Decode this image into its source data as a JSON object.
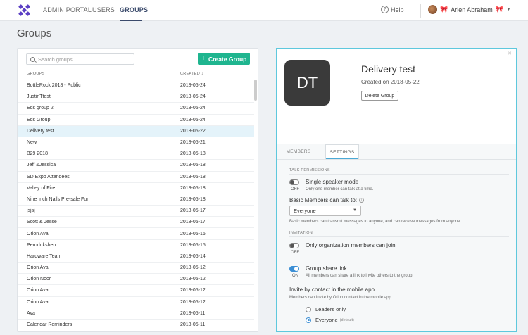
{
  "topnav": {
    "items": [
      {
        "label": "ADMIN PORTAL",
        "active": false
      },
      {
        "label": "USERS",
        "active": false
      },
      {
        "label": "GROUPS",
        "active": true
      }
    ],
    "help_label": "Help",
    "user_name": "Arlen Abraham"
  },
  "page": {
    "title": "Groups"
  },
  "groups_list": {
    "search_placeholder": "Search groups",
    "create_button_label": "Create Group",
    "columns": {
      "name": "GROUPS",
      "created": "CREATED"
    },
    "rows": [
      {
        "name": "BottleRock 2018 - Public",
        "created": "2018-05-24"
      },
      {
        "name": "JustinTtest",
        "created": "2018-05-24"
      },
      {
        "name": "Eds group 2",
        "created": "2018-05-24"
      },
      {
        "name": "Eds Group",
        "created": "2018-05-24"
      },
      {
        "name": "Delivery test",
        "created": "2018-05-22",
        "selected": true
      },
      {
        "name": "New",
        "created": "2018-05-21"
      },
      {
        "name": "B29 2018",
        "created": "2018-05-18"
      },
      {
        "name": "Jeff &Jessica",
        "created": "2018-05-18"
      },
      {
        "name": "SD Expo Attendees",
        "created": "2018-05-18"
      },
      {
        "name": "Valley of Fire",
        "created": "2018-05-18"
      },
      {
        "name": "Nine Inch Nails Pre-sale Fun",
        "created": "2018-05-18"
      },
      {
        "name": "jsjsj",
        "created": "2018-05-17"
      },
      {
        "name": "Scott & Jesse",
        "created": "2018-05-17"
      },
      {
        "name": "Orion Ava",
        "created": "2018-05-16"
      },
      {
        "name": "Perodukshen",
        "created": "2018-05-15"
      },
      {
        "name": "Hardware Team",
        "created": "2018-05-14"
      },
      {
        "name": "Orion Ava",
        "created": "2018-05-12"
      },
      {
        "name": "Orion Noor",
        "created": "2018-05-12"
      },
      {
        "name": "Orion Ava",
        "created": "2018-05-12"
      },
      {
        "name": "Orion Ava",
        "created": "2018-05-12"
      },
      {
        "name": "Ava",
        "created": "2018-05-11"
      },
      {
        "name": "Calendar Reminders",
        "created": "2018-05-11"
      }
    ]
  },
  "detail": {
    "initials": "DT",
    "name": "Delivery test",
    "created_text": "Created on 2018-05-22",
    "delete_label": "Delete Group",
    "tabs": [
      {
        "label": "MEMBERS",
        "active": false
      },
      {
        "label": "SETTINGS",
        "active": true
      }
    ],
    "talk_permissions_label": "TALK PERMISSIONS",
    "single_speaker": {
      "title": "Single speaker mode",
      "desc": "Only one member can talk at a time.",
      "state": "OFF"
    },
    "basic_members_label": "Basic Members can talk to:",
    "basic_members_value": "Everyone",
    "basic_members_desc": "Basic members can transmit messages to anyone, and can receive messages from anyone.",
    "invitation_label": "INVITATION",
    "org_only": {
      "title": "Only organization members can join",
      "state": "OFF"
    },
    "share_link": {
      "title": "Group share link",
      "desc": "All members can share a link to invite others to the group.",
      "state": "ON"
    },
    "invite_contact": {
      "title": "Invite by contact in the mobile app",
      "desc": "Members can invite by Orion contact in the mobile app.",
      "options": [
        {
          "label": "Leaders only",
          "checked": false
        },
        {
          "label": "Everyone",
          "checked": true,
          "tag": "(default)"
        }
      ]
    }
  },
  "colors": {
    "brand": "#5b3fc4",
    "accent_green": "#1fb58f",
    "toggle_on": "#3b8ed4",
    "selected_row": "#e4f3fa",
    "panel_border": "#5ec8dd"
  }
}
